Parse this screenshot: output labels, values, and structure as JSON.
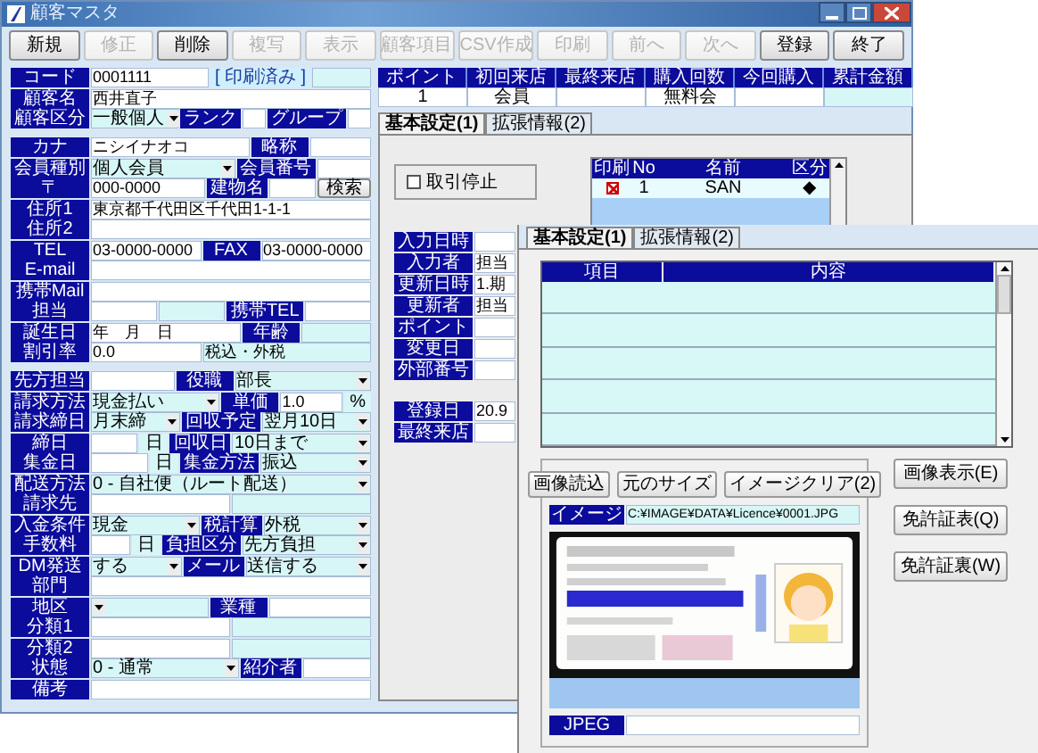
{
  "window": {
    "title": "顧客マスタ"
  },
  "toolbar": [
    {
      "label": "新規",
      "disabled": false
    },
    {
      "label": "修正",
      "disabled": true
    },
    {
      "label": "削除",
      "disabled": false
    },
    {
      "label": "複写",
      "disabled": true
    },
    {
      "label": "表示",
      "disabled": true
    },
    {
      "label": "顧客項目",
      "disabled": true
    },
    {
      "label": "CSV作成",
      "disabled": true
    },
    {
      "label": "印刷",
      "disabled": true
    },
    {
      "label": "前へ",
      "disabled": true
    },
    {
      "label": "次へ",
      "disabled": true
    },
    {
      "label": "登録",
      "disabled": false
    },
    {
      "label": "終了",
      "disabled": false
    }
  ],
  "customer_form": {
    "sections": [
      [
        [
          {
            "kind": "label",
            "text": "コード"
          },
          {
            "kind": "field",
            "value": "0001111"
          },
          {
            "kind": "note",
            "text": "[ 印刷済み ]"
          },
          {
            "kind": "shaded"
          }
        ],
        [
          {
            "kind": "label",
            "text": "顧客名"
          },
          {
            "kind": "field",
            "value": "西井直子"
          }
        ],
        [
          {
            "kind": "label",
            "text": "顧客区分"
          },
          {
            "kind": "select",
            "value": "一般個人"
          },
          {
            "kind": "label",
            "text": "ランク"
          },
          {
            "kind": "field"
          },
          {
            "kind": "label",
            "text": "グループ"
          },
          {
            "kind": "field"
          }
        ]
      ],
      [
        [
          {
            "kind": "label",
            "text": "カナ"
          },
          {
            "kind": "field",
            "value": "ニシイナオコ"
          },
          {
            "kind": "label",
            "text": "略称"
          },
          {
            "kind": "field"
          }
        ],
        [
          {
            "kind": "label",
            "text": "会員種別"
          },
          {
            "kind": "select",
            "value": "個人会員"
          },
          {
            "kind": "label",
            "text": "会員番号"
          },
          {
            "kind": "field"
          }
        ],
        [
          {
            "kind": "label",
            "text": "〒"
          },
          {
            "kind": "field",
            "value": "000-0000"
          },
          {
            "kind": "label",
            "text": "建物名"
          },
          {
            "kind": "field"
          },
          {
            "kind": "button",
            "text": "検索"
          }
        ],
        [
          {
            "kind": "label",
            "text": "住所1"
          },
          {
            "kind": "field",
            "value": "東京都千代田区千代田1-1-1"
          }
        ],
        [
          {
            "kind": "label",
            "text": "住所2"
          },
          {
            "kind": "field"
          }
        ],
        [
          {
            "kind": "label",
            "text": "TEL"
          },
          {
            "kind": "field",
            "value": "03-0000-0000"
          },
          {
            "kind": "label",
            "text": "FAX"
          },
          {
            "kind": "field",
            "value": "03-0000-0000"
          }
        ],
        [
          {
            "kind": "label",
            "text": "E-mail"
          },
          {
            "kind": "field"
          }
        ],
        [
          {
            "kind": "label",
            "text": "携帯Mail"
          },
          {
            "kind": "field"
          }
        ],
        [
          {
            "kind": "label",
            "text": "担当"
          },
          {
            "kind": "field"
          },
          {
            "kind": "shaded"
          },
          {
            "kind": "label",
            "text": "携帯TEL"
          },
          {
            "kind": "field"
          }
        ],
        [
          {
            "kind": "label",
            "text": "誕生日"
          },
          {
            "kind": "field",
            "value": "年　月　日"
          },
          {
            "kind": "label",
            "text": "年齢"
          },
          {
            "kind": "shaded"
          }
        ],
        [
          {
            "kind": "label",
            "text": "割引率"
          },
          {
            "kind": "field",
            "value": "0.0"
          },
          {
            "kind": "shaded",
            "value": "税込・外税"
          }
        ]
      ],
      [
        [
          {
            "kind": "label",
            "text": "先方担当"
          },
          {
            "kind": "field"
          },
          {
            "kind": "label",
            "text": "役職"
          },
          {
            "kind": "select",
            "value": "部長"
          }
        ],
        [
          {
            "kind": "label",
            "text": "請求方法"
          },
          {
            "kind": "select",
            "value": "現金払い"
          },
          {
            "kind": "label",
            "text": "単価"
          },
          {
            "kind": "field",
            "value": "1.0"
          },
          {
            "kind": "unit",
            "text": "%"
          }
        ],
        [
          {
            "kind": "label",
            "text": "請求締日"
          },
          {
            "kind": "select",
            "value": "月末締"
          },
          {
            "kind": "label",
            "text": "回収予定"
          },
          {
            "kind": "select",
            "value": "翌月10日"
          }
        ],
        [
          {
            "kind": "label",
            "text": "締日"
          },
          {
            "kind": "field"
          },
          {
            "kind": "unit",
            "text": "日"
          },
          {
            "kind": "label",
            "text": "回収日"
          },
          {
            "kind": "select",
            "value": "10日まで"
          }
        ],
        [
          {
            "kind": "label",
            "text": "集金日"
          },
          {
            "kind": "field"
          },
          {
            "kind": "unit",
            "text": "日"
          },
          {
            "kind": "label",
            "text": "集金方法"
          },
          {
            "kind": "select",
            "value": "振込"
          }
        ],
        [
          {
            "kind": "label",
            "text": "配送方法"
          },
          {
            "kind": "select",
            "value": "0 - 自社便（ルート配送）"
          }
        ],
        [
          {
            "kind": "label",
            "text": "請求先"
          },
          {
            "kind": "field"
          },
          {
            "kind": "shaded"
          }
        ],
        [
          {
            "kind": "label",
            "text": "入金条件"
          },
          {
            "kind": "select",
            "value": "現金"
          },
          {
            "kind": "label",
            "text": "税計算"
          },
          {
            "kind": "select",
            "value": "外税"
          }
        ],
        [
          {
            "kind": "label",
            "text": "手数料"
          },
          {
            "kind": "field"
          },
          {
            "kind": "unit",
            "text": "日"
          },
          {
            "kind": "label",
            "text": "負担区分"
          },
          {
            "kind": "select",
            "value": "先方負担"
          }
        ],
        [
          {
            "kind": "label",
            "text": "DM発送"
          },
          {
            "kind": "select",
            "value": "する"
          },
          {
            "kind": "label",
            "text": "メール"
          },
          {
            "kind": "select",
            "value": "送信する"
          }
        ],
        [
          {
            "kind": "label",
            "text": "部門"
          },
          {
            "kind": "field"
          }
        ],
        [
          {
            "kind": "label",
            "text": "地区"
          },
          {
            "kind": "select"
          },
          {
            "kind": "label",
            "text": "業種"
          },
          {
            "kind": "field"
          }
        ],
        [
          {
            "kind": "label",
            "text": "分類1"
          },
          {
            "kind": "field"
          },
          {
            "kind": "shaded"
          }
        ],
        [
          {
            "kind": "label",
            "text": "分類2"
          },
          {
            "kind": "field"
          },
          {
            "kind": "shaded"
          }
        ],
        [
          {
            "kind": "label",
            "text": "状態"
          },
          {
            "kind": "select",
            "value": "0 - 通常"
          },
          {
            "kind": "label",
            "text": "紹介者"
          },
          {
            "kind": "field"
          }
        ],
        [
          {
            "kind": "label",
            "text": "備考"
          },
          {
            "kind": "field"
          }
        ]
      ]
    ]
  },
  "summary_table": {
    "columns": [
      {
        "header": "ポイント",
        "value": "1"
      },
      {
        "header": "初回来店",
        "value": "会員"
      },
      {
        "header": "最終来店"
      },
      {
        "header": "購入回数",
        "value": "無料会"
      },
      {
        "header": "今回購入"
      },
      {
        "header": "累計金額"
      }
    ]
  },
  "tabs": [
    {
      "label": "基本設定(1)",
      "selected": true
    },
    {
      "label": "拡張情報(2)",
      "selected": false
    }
  ],
  "suspended": {
    "label": "取引停止",
    "checked": false
  },
  "contacts": {
    "columns": [
      "印刷",
      "No",
      "名前",
      "区分"
    ],
    "rows": [
      {
        "print": true,
        "no": "1",
        "name": "SAN",
        "type": "◆"
      }
    ]
  },
  "record_info": [
    [
      {
        "label": "入力日時"
      },
      {
        "label": "入力者",
        "value": "担当"
      },
      {
        "label": "更新日時",
        "value": "1.期"
      },
      {
        "label": "更新者",
        "value": "担当"
      },
      {
        "label": "ポイント"
      },
      {
        "label": "変更日"
      },
      {
        "label": "外部番号"
      }
    ],
    [
      {
        "label": "登録日",
        "value": "20.9"
      },
      {
        "label": "最終来店"
      }
    ]
  ],
  "detail_window": {
    "tabs": [
      {
        "label": "基本設定(1)",
        "selected": true
      },
      {
        "label": "拡張情報(2)",
        "selected": false
      }
    ],
    "grid": {
      "columns": [
        "項目",
        "内容"
      ]
    },
    "image_buttons": [
      "画像読込",
      "元のサイズ",
      "イメージクリア(2)"
    ],
    "path": {
      "label": "イメージ",
      "value": "C:¥IMAGE¥DATA¥Licence¥0001.JPG"
    },
    "image": {
      "kind": "picture"
    },
    "format": {
      "label": "JPEG"
    },
    "side_buttons": [
      "画像表示(E)",
      "免許証表(Q)",
      "免許証裏(W)"
    ]
  }
}
